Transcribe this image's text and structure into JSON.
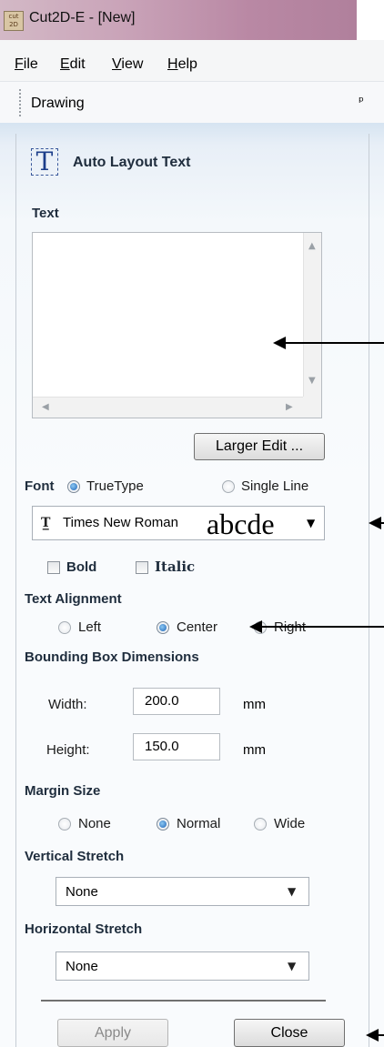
{
  "window": {
    "title": "Cut2D-E - [New]",
    "icon_text": "cut 2D"
  },
  "menu": {
    "file": "File",
    "edit": "Edit",
    "view": "View",
    "help": "Help"
  },
  "panel": {
    "title": "Drawing",
    "pin_icon": "pin-icon"
  },
  "section": {
    "title": "Auto Layout Text",
    "icon": "text-tool-icon"
  },
  "text": {
    "label": "Text",
    "value": "",
    "larger_edit": "Larger Edit ..."
  },
  "font": {
    "label": "Font",
    "truetype": "TrueType",
    "single_line": "Single Line",
    "selected_type": "TrueType",
    "font_name": "Times New Roman",
    "sample": "abcde",
    "bold": "Bold",
    "italic": "Italic"
  },
  "alignment": {
    "label": "Text Alignment",
    "left": "Left",
    "center": "Center",
    "right": "Right",
    "selected": "Center"
  },
  "bbox": {
    "label": "Bounding Box Dimensions",
    "width_label": "Width:",
    "width_value": "200.0",
    "height_label": "Height:",
    "height_value": "150.0",
    "unit": "mm"
  },
  "margin": {
    "label": "Margin Size",
    "none": "None",
    "normal": "Normal",
    "wide": "Wide",
    "selected": "Normal"
  },
  "vertical_stretch": {
    "label": "Vertical Stretch",
    "value": "None"
  },
  "horizontal_stretch": {
    "label": "Horizontal Stretch",
    "value": "None"
  },
  "buttons": {
    "apply": "Apply",
    "close": "Close"
  }
}
